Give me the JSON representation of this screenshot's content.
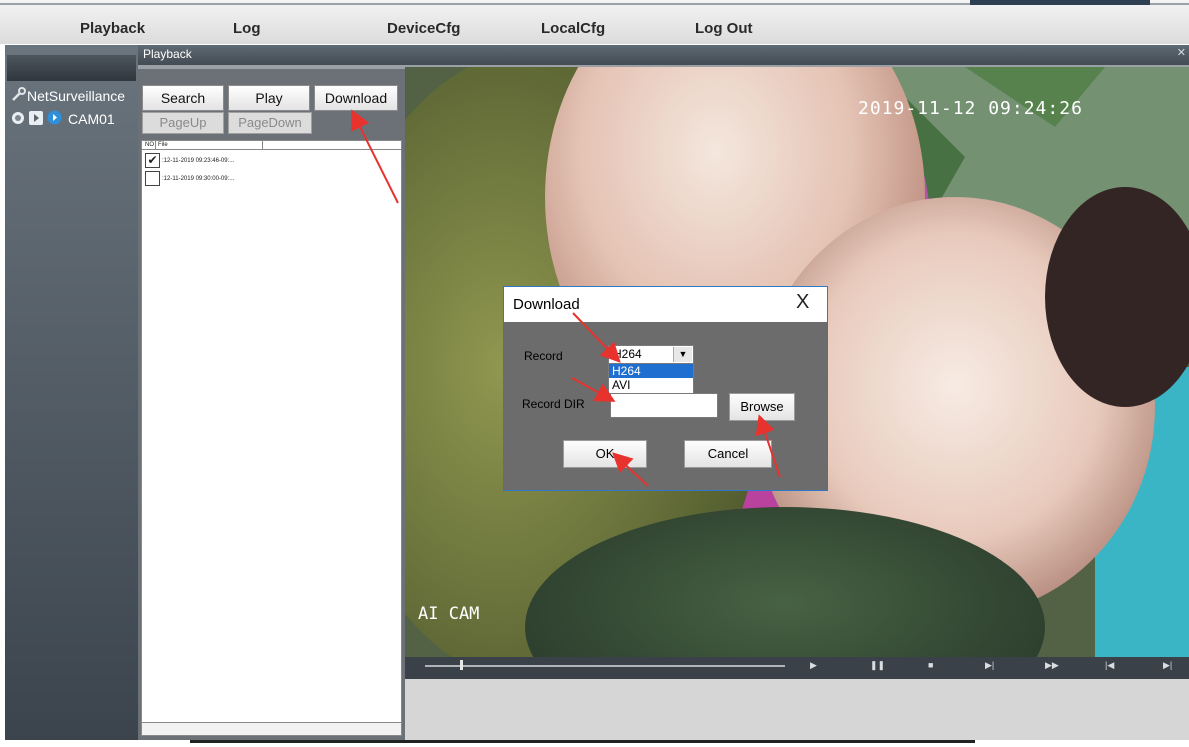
{
  "topnav": {
    "items": [
      "Playback",
      "Log",
      "DeviceCfg",
      "LocalCfg",
      "Log Out"
    ]
  },
  "sidebar": {
    "root_label": "NetSurveillance",
    "camera_label": "CAM01"
  },
  "playback": {
    "title": "Playback",
    "buttons": {
      "search": "Search",
      "play": "Play",
      "download": "Download",
      "pageup": "PageUp",
      "pagedown": "PageDown"
    },
    "list_headers": [
      "NO",
      "File"
    ],
    "files": [
      {
        "checked": true,
        "name": ":12-11-2019 09:23:46-09:..."
      },
      {
        "checked": false,
        "name": ":12-11-2019 09:30:00-09:..."
      }
    ]
  },
  "video": {
    "timestamp": "2019-11-12 09:24:26",
    "camera_name": "AI CAM"
  },
  "dialog": {
    "title": "Download",
    "close": "X",
    "record_label": "Record",
    "record_value": "H264",
    "record_options": [
      "H264",
      "AVI"
    ],
    "record_dir_label": "Record DIR",
    "record_dir_value": "",
    "browse": "Browse",
    "ok": "OK",
    "cancel": "Cancel"
  },
  "colors": {
    "annotation_arrow": "#e8322e",
    "dialog_border": "#2f78c7",
    "selected_option": "#1f6fd1"
  }
}
